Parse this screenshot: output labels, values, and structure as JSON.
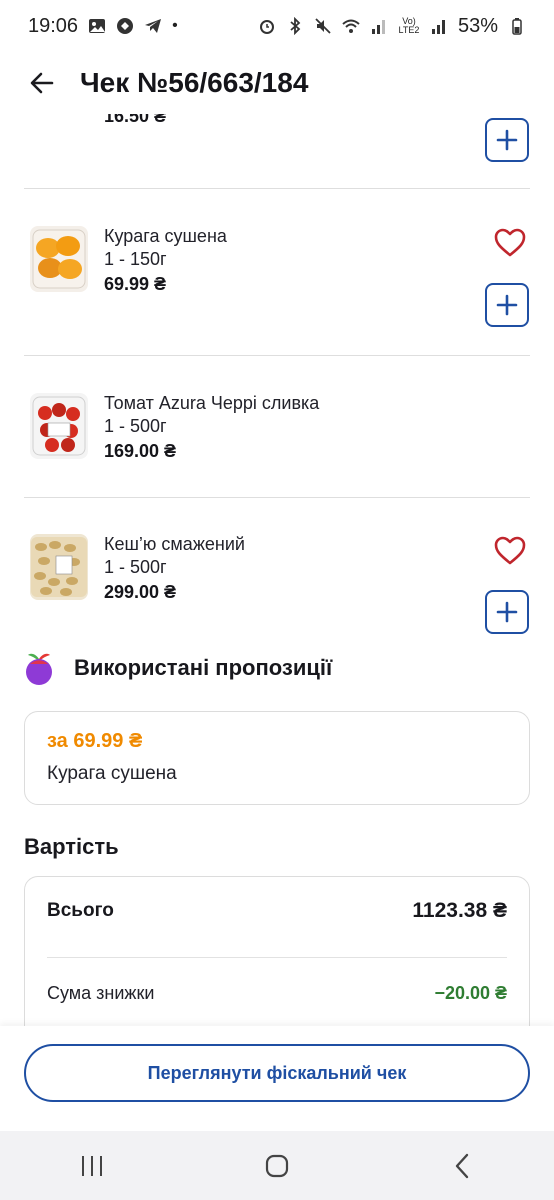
{
  "status": {
    "time": "19:06",
    "battery": "53%",
    "network": "Vo) LTE2"
  },
  "header": {
    "title": "Чек №56/663/184"
  },
  "partial_item": {
    "price": "16.50 ₴"
  },
  "items": [
    {
      "name": "Курага сушена",
      "qty": "1 - 150г",
      "price": "69.99 ₴",
      "favorite": true,
      "can_add": true
    },
    {
      "name": "Томат Azura Черрі сливка",
      "qty": "1 - 500г",
      "price": "169.00 ₴",
      "favorite": false,
      "can_add": false
    },
    {
      "name": "Кеш’ю смажений",
      "qty": "1 - 500г",
      "price": "299.00 ₴",
      "favorite": true,
      "can_add": true
    }
  ],
  "offers": {
    "title": "Використані пропозиції",
    "card": {
      "price": "за 69.99 ₴",
      "name": "Курага сушена"
    }
  },
  "cost": {
    "title": "Вартість",
    "total_label": "Всього",
    "total_value": "1123.38 ₴",
    "discount_label": "Сума знижки",
    "discount_value": "−20.00 ₴"
  },
  "actions": {
    "fiscal_button": "Переглянути фіскальний чек"
  },
  "colors": {
    "accent": "#1f4fa3",
    "heart": "#c0262d",
    "offer": "#f08a00",
    "discount": "#2f7d32"
  },
  "icons": [
    "back-arrow-icon",
    "heart-icon",
    "plus-icon",
    "fruit-logo-icon",
    "recent-apps-icon",
    "home-icon",
    "back-nav-icon"
  ]
}
